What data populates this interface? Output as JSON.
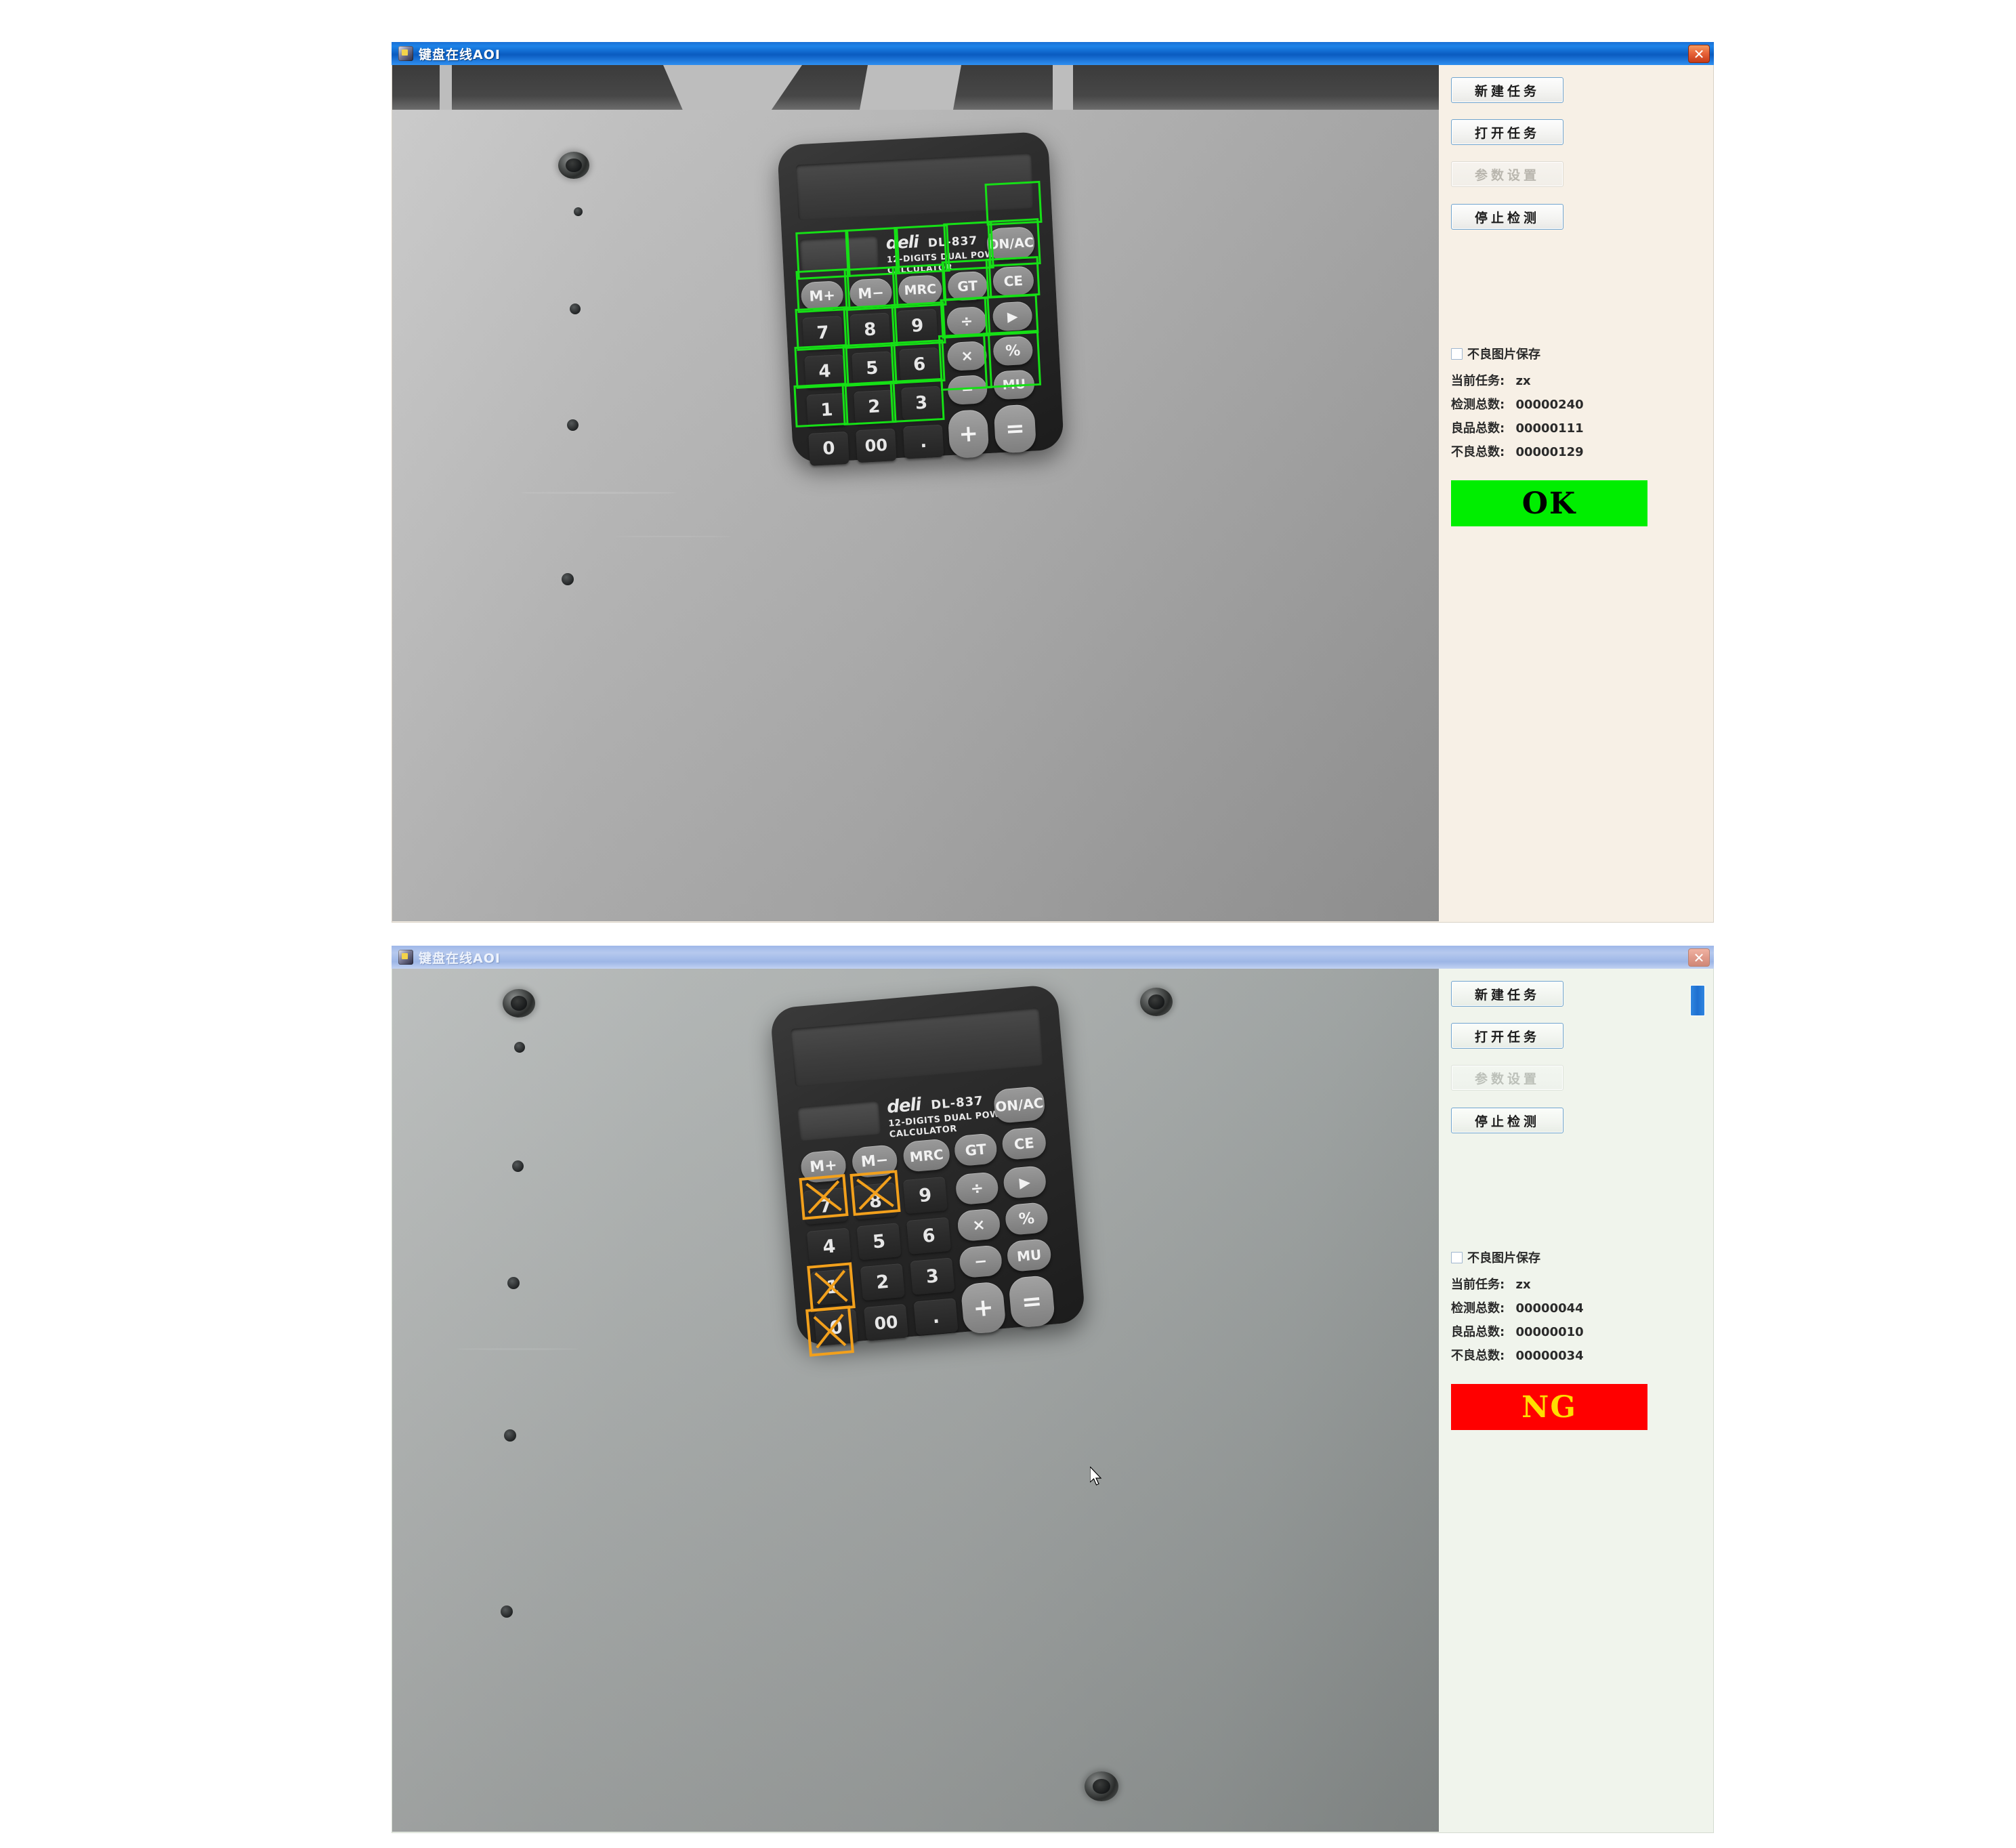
{
  "windows": [
    {
      "title": "键盘在线AOI",
      "close_icon": "✕",
      "state": "active",
      "buttons": [
        {
          "label": "新建任务",
          "name": "new-task-button",
          "disabled": false
        },
        {
          "label": "打开任务",
          "name": "open-task-button",
          "disabled": false
        },
        {
          "label": "参数设置",
          "name": "parameter-settings-button",
          "disabled": true
        },
        {
          "label": "停止检测",
          "name": "stop-inspection-button",
          "disabled": false
        }
      ],
      "checkbox": {
        "label": "不良图片保存",
        "checked": false
      },
      "stats": [
        {
          "label": "当前任务:",
          "value": "zx"
        },
        {
          "label": "检测总数:",
          "value": "00000240"
        },
        {
          "label": "良品总数:",
          "value": "00000111"
        },
        {
          "label": "不良总数:",
          "value": "00000129"
        }
      ],
      "verdict": {
        "text": "OK",
        "bg": "#00ee00",
        "fg": "#000000"
      },
      "calculator": {
        "brand": "deli",
        "model": "DL-837",
        "line1": "12-DIGITS DUAL POWER",
        "line2": "CALCULATOR",
        "keys_row_mem": [
          "M+",
          "M−",
          "MRC",
          "GT",
          "CE"
        ],
        "keys_digits": [
          "7",
          "8",
          "9",
          "4",
          "5",
          "6",
          "1",
          "2",
          "3",
          "0",
          "00",
          "."
        ],
        "keys_ops": [
          "ON/AC",
          "÷",
          "▶",
          "×",
          "%",
          "−",
          "MU",
          "+",
          "="
        ]
      },
      "overlay": {
        "mode": "pass",
        "color": "#16e016",
        "defect_keys": []
      }
    },
    {
      "title": "键盘在线AOI",
      "close_icon": "✕",
      "state": "inactive",
      "buttons": [
        {
          "label": "新建任务",
          "name": "new-task-button",
          "disabled": false
        },
        {
          "label": "打开任务",
          "name": "open-task-button",
          "disabled": false
        },
        {
          "label": "参数设置",
          "name": "parameter-settings-button",
          "disabled": true
        },
        {
          "label": "停止检测",
          "name": "stop-inspection-button",
          "disabled": false
        }
      ],
      "checkbox": {
        "label": "不良图片保存",
        "checked": false
      },
      "stats": [
        {
          "label": "当前任务:",
          "value": "zx"
        },
        {
          "label": "检测总数:",
          "value": "00000044"
        },
        {
          "label": "良品总数:",
          "value": "00000010"
        },
        {
          "label": "不良总数:",
          "value": "00000034"
        }
      ],
      "verdict": {
        "text": "NG",
        "bg": "#ff0000",
        "fg": "#ffdd00"
      },
      "calculator": {
        "brand": "deli",
        "model": "DL-837",
        "line1": "12-DIGITS DUAL POWER",
        "line2": "CALCULATOR",
        "keys_row_mem": [
          "M+",
          "M−",
          "MRC",
          "GT",
          "CE"
        ],
        "keys_digits": [
          "7",
          "8",
          "9",
          "4",
          "5",
          "6",
          "1",
          "2",
          "3",
          "0",
          "00",
          "."
        ],
        "keys_ops": [
          "ON/AC",
          "÷",
          "▶",
          "×",
          "%",
          "−",
          "MU",
          "+",
          "="
        ]
      },
      "overlay": {
        "mode": "fail",
        "color": "#f2a01c",
        "defect_keys": [
          "7",
          "8",
          "0",
          "1"
        ]
      }
    }
  ]
}
